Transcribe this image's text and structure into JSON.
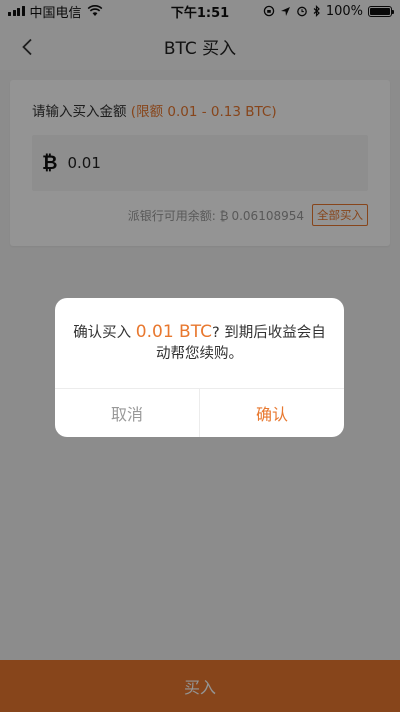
{
  "status_bar": {
    "carrier": "中国电信",
    "time": "下午1:51",
    "battery": "100%"
  },
  "nav": {
    "title": "BTC 买入"
  },
  "card": {
    "prompt": "请输入买入金额",
    "limit": "(限额 0.01 - 0.13 BTC)",
    "btc_symbol": "₿",
    "amount": "0.01",
    "balance_label": "派银行可用余额:",
    "balance_symbol": "₿",
    "balance_value": "0.06108954",
    "all_in_label": "全部买入"
  },
  "bottom_button": {
    "label": "买入"
  },
  "dialog": {
    "prefix": "确认买入",
    "amount": "0.01 BTC",
    "suffix": "? 到期后收益会自动帮您续购。",
    "cancel_label": "取消",
    "confirm_label": "确认"
  },
  "colors": {
    "accent": "#e8782f"
  }
}
